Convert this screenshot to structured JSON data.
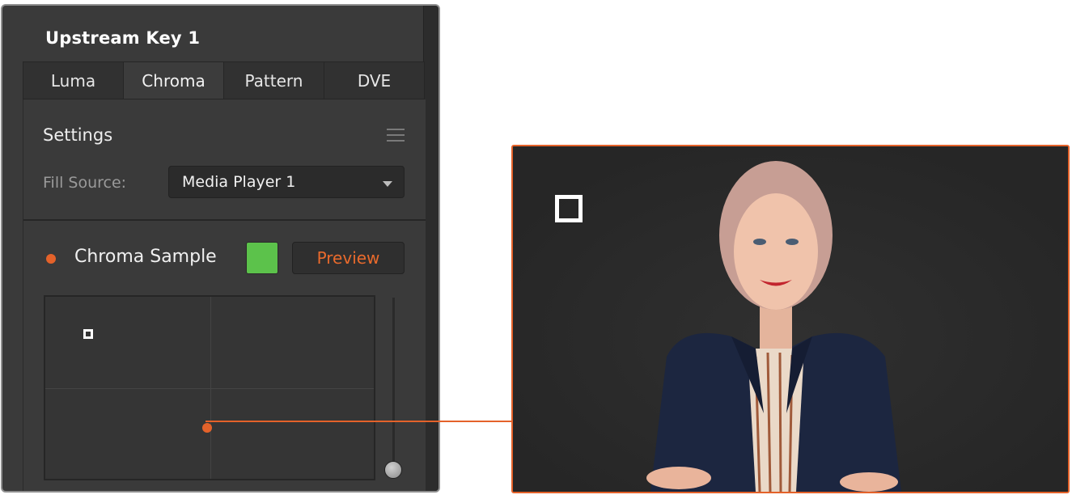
{
  "panel": {
    "title": "Upstream Key 1",
    "tabs": [
      "Luma",
      "Chroma",
      "Pattern",
      "DVE"
    ],
    "active_tab": "Chroma",
    "settings": {
      "title": "Settings",
      "fill_source_label": "Fill Source:",
      "fill_source_value": "Media Player 1"
    },
    "chroma_sample": {
      "label": "Chroma Sample",
      "swatch_color": "#5cc24b",
      "preview_label": "Preview"
    }
  },
  "colors": {
    "accent": "#e4622a",
    "panel_bg": "#3a3a3a"
  },
  "icons": {
    "menu": "hamburger-menu-icon",
    "dropdown": "chevron-down-icon"
  }
}
